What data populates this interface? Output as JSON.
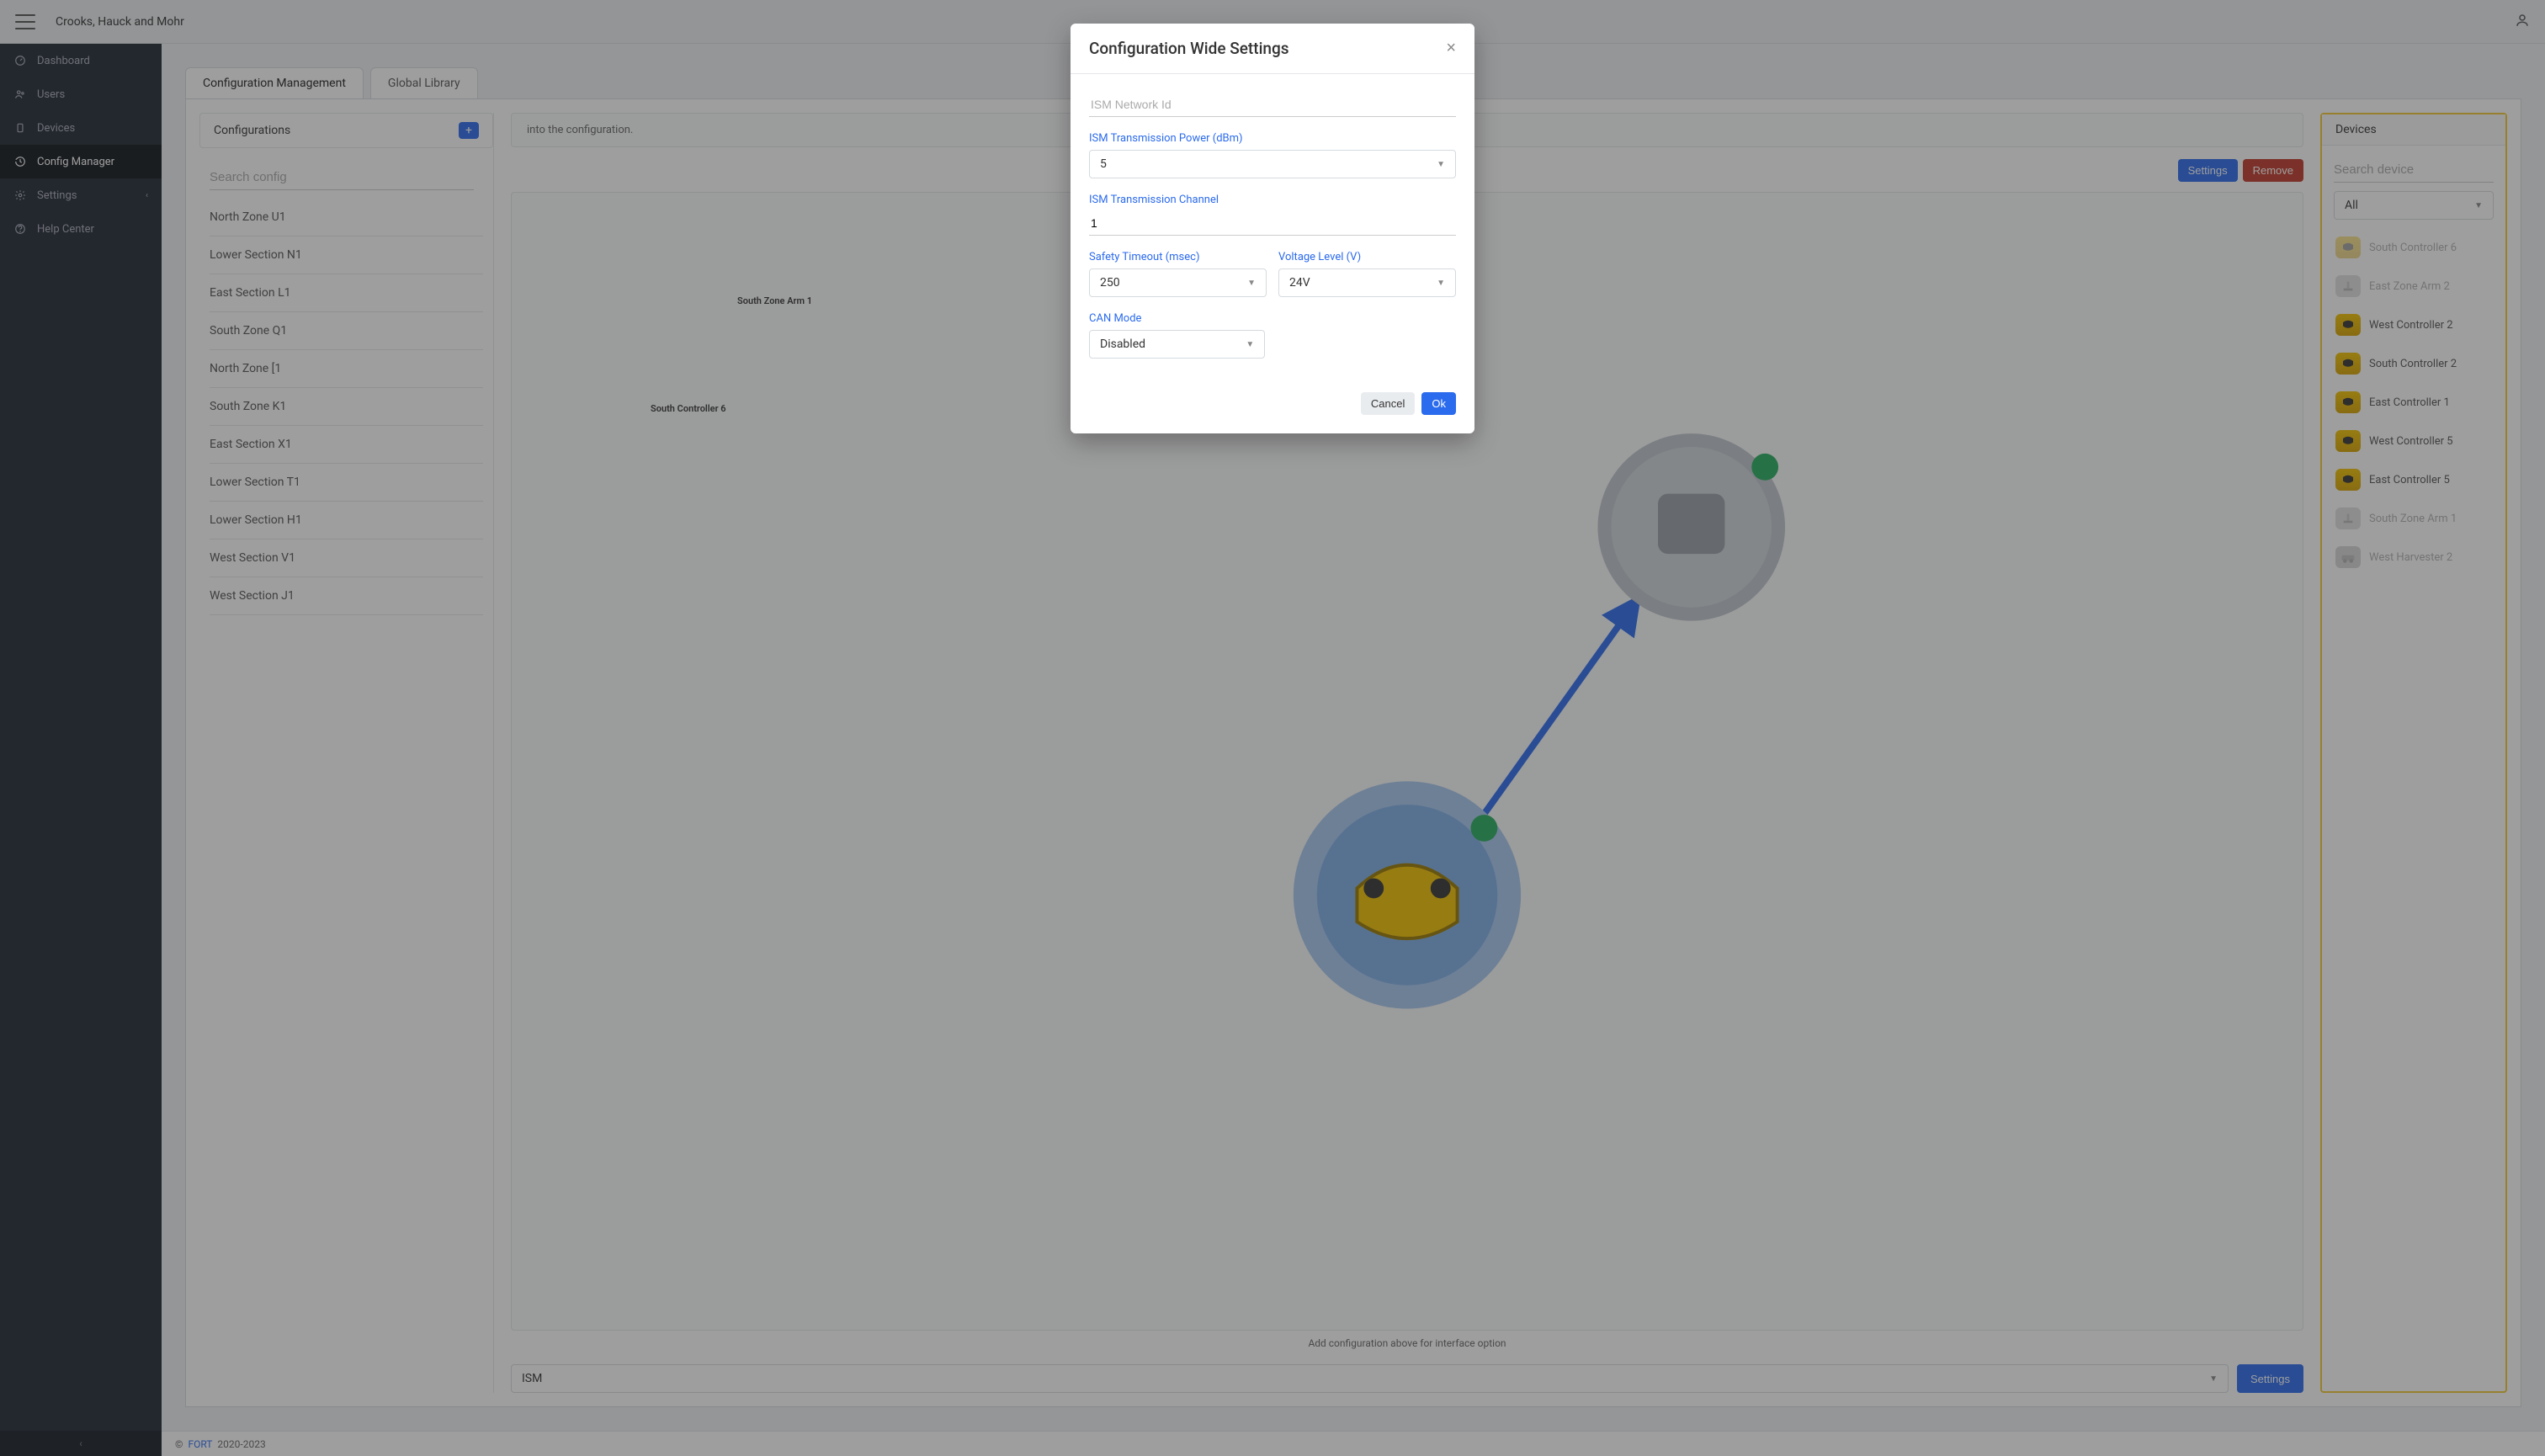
{
  "topbar": {
    "brand": "Crooks, Hauck and Mohr"
  },
  "sidebar": {
    "items": [
      {
        "label": "Dashboard",
        "icon": "dashboard-icon"
      },
      {
        "label": "Users",
        "icon": "users-icon"
      },
      {
        "label": "Devices",
        "icon": "devices-icon"
      },
      {
        "label": "Config Manager",
        "icon": "history-icon",
        "active": true
      },
      {
        "label": "Settings",
        "icon": "gear-icon",
        "hasChildren": true
      },
      {
        "label": "Help Center",
        "icon": "help-icon"
      }
    ]
  },
  "tabs": {
    "configManagement": "Configuration Management",
    "globalLibrary": "Global Library"
  },
  "configurations": {
    "title": "Configurations",
    "searchPlaceholder": "Search config",
    "items": [
      "North Zone U1",
      "Lower Section N1",
      "East Section L1",
      "South Zone Q1",
      "North Zone [1",
      "South Zone K1",
      "East Section X1",
      "Lower Section T1",
      "Lower Section H1",
      "West Section V1",
      "West Section J1"
    ]
  },
  "main": {
    "dragText": "into the configuration.",
    "settingsBtn": "Settings",
    "removeBtn": "Remove",
    "node1": "South Zone Arm 1",
    "node2": "South Controller 6",
    "caption": "Add configuration above for interface option",
    "interfaceSelect": "ISM",
    "interfaceSettings": "Settings"
  },
  "devices": {
    "title": "Devices",
    "searchPlaceholder": "Search device",
    "filter": "All",
    "items": [
      {
        "label": "South Controller 6",
        "type": "controller",
        "disabled": true
      },
      {
        "label": "East Zone Arm 2",
        "type": "arm",
        "disabled": true
      },
      {
        "label": "West Controller 2",
        "type": "controller"
      },
      {
        "label": "South Controller 2",
        "type": "controller"
      },
      {
        "label": "East Controller 1",
        "type": "controller"
      },
      {
        "label": "West Controller 5",
        "type": "controller"
      },
      {
        "label": "East Controller 5",
        "type": "controller"
      },
      {
        "label": "South Zone Arm 1",
        "type": "arm",
        "disabled": true
      },
      {
        "label": "West Harvester 2",
        "type": "harvester",
        "disabled": true
      }
    ]
  },
  "footer": {
    "copyright": "©",
    "link": "FORT",
    "years": "2020-2023"
  },
  "modal": {
    "title": "Configuration Wide Settings",
    "networkIdPlaceholder": "ISM Network Id",
    "networkIdValue": "",
    "txPowerLabel": "ISM Transmission Power (dBm)",
    "txPowerValue": "5",
    "txChannelLabel": "ISM Transmission Channel",
    "txChannelValue": "1",
    "safetyTimeoutLabel": "Safety Timeout (msec)",
    "safetyTimeoutValue": "250",
    "voltageLabel": "Voltage Level (V)",
    "voltageValue": "24V",
    "canModeLabel": "CAN Mode",
    "canModeValue": "Disabled",
    "cancel": "Cancel",
    "ok": "Ok"
  }
}
